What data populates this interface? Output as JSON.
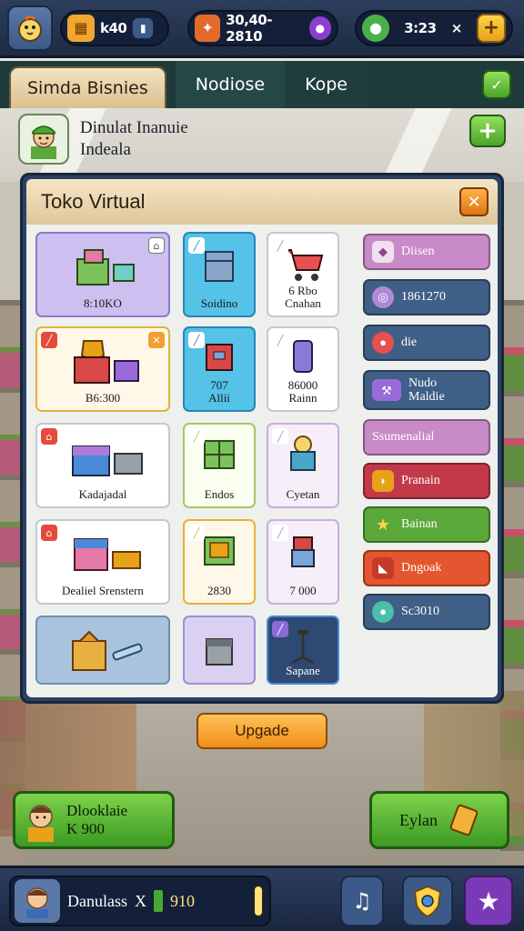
{
  "top_bar": {
    "level_value": "k40",
    "cash_value": "30,40-2810",
    "gems_value": "3:23",
    "gems_multiplier": "×",
    "colors": {
      "bar": "#24354f",
      "cash_icon": "#8a3fd1",
      "plus": "#f1b72b"
    }
  },
  "tabs": [
    {
      "label": "Simda Bisnies"
    },
    {
      "label": "Nodiose"
    },
    {
      "label": "Kope"
    }
  ],
  "profile": {
    "name": "Dinulat Inanuie",
    "subtitle": "Indeala"
  },
  "shop": {
    "title": "Toko Virtual",
    "items": [
      {
        "label": "8:10KO",
        "color": "purple",
        "icon": "shop-boxes-icon"
      },
      {
        "label": "Soidino",
        "color": "blue",
        "icon": "blue-box-icon"
      },
      {
        "label": "6 Rbo",
        "label2": "Cnahan",
        "color": "white",
        "icon": "shopping-cart-icon"
      },
      {
        "label": "B6:300",
        "color": "yellow",
        "icon": "gift-boxes-icon"
      },
      {
        "label": "707",
        "label2": "Allii",
        "color": "blue",
        "icon": "red-box-icon"
      },
      {
        "label": "86000",
        "label2": "Rainn",
        "color": "white",
        "icon": "purple-can-icon"
      },
      {
        "label": "Kadajadal",
        "color": "white",
        "icon": "crates-icon"
      },
      {
        "label": "Endos",
        "color": "green",
        "icon": "green-crate-icon"
      },
      {
        "label": "Cyetan",
        "color": "pink",
        "icon": "machine-icon"
      },
      {
        "label": "Dealiel Srenstern",
        "color": "white",
        "icon": "pink-box-icon"
      },
      {
        "label": "2830",
        "color": "yellow",
        "icon": "colorful-crate-icon"
      },
      {
        "label": "7 000",
        "color": "pink",
        "icon": "red-machine-icon"
      },
      {
        "label": "",
        "color": "lightblue",
        "icon": "tools-box-icon"
      },
      {
        "label": "",
        "color": "lilac",
        "icon": "grey-box-icon"
      },
      {
        "label": "Sapane",
        "color": "dark",
        "icon": "stand-icon"
      }
    ],
    "side_buttons": [
      {
        "label": "Diisen",
        "bg": "#c88ac8",
        "icon": "tag-icon"
      },
      {
        "label": "1861270",
        "bg": "#3f5f86",
        "icon": "coin-icon"
      },
      {
        "label": "die",
        "bg": "#3f5f86",
        "icon": "record-icon"
      },
      {
        "label": "Nudo",
        "label2": "Maldie",
        "bg": "#3f5f86",
        "icon": "hammer-icon"
      },
      {
        "label": "Ssumenalial",
        "bg": "#c88ac8",
        "icon": "none"
      },
      {
        "label": "Pranain",
        "bg": "#c23a4a",
        "icon": "bread-icon"
      },
      {
        "label": "Bainan",
        "bg": "#5aa83a",
        "icon": "star-icon"
      },
      {
        "label": "Dngoak",
        "bg": "#e5552f",
        "icon": "fish-icon"
      },
      {
        "label": "Sc3010",
        "bg": "#3f5f86",
        "icon": "blob-icon"
      }
    ]
  },
  "upgrade_label": "Upgade",
  "bottom_actions": {
    "left_title": "Dlooklaie",
    "left_amount": "K 900",
    "right_label": "Eylan"
  },
  "bottom_bar": {
    "player_name": "Danulass",
    "player_mult": "X",
    "player_money": "910"
  }
}
